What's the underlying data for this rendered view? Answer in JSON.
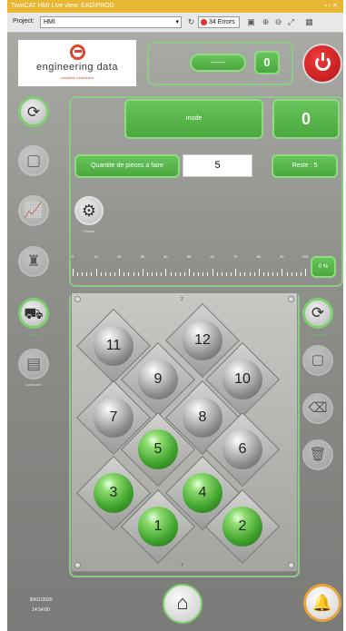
{
  "window": {
    "title": "TwinCAT HMI Live view: EAD\\PROD",
    "controls": "▪ ▫ ✕"
  },
  "toolbar": {
    "project_label": "Project:",
    "project_value": "HMI",
    "errors_label": "34 Errors"
  },
  "logo": {
    "name": "engineering data",
    "tagline": "complete confidence"
  },
  "top_panel": {
    "pill_label": "——",
    "counter_value": "0"
  },
  "main": {
    "mode_label": "mode",
    "counter_value": "0",
    "quantity_label": "Quantite de pieces a faire",
    "quantity_value": "5",
    "remaining_label": "Reste : 5",
    "settings_caption": "Param",
    "progress_label": "0 %",
    "progress_percent": 0,
    "ruler_labels": [
      "0",
      "10",
      "20",
      "30",
      "40",
      "50",
      "60",
      "70",
      "80",
      "90",
      "100"
    ]
  },
  "left_nav": [
    {
      "icon": "overview-icon",
      "caption": "Production",
      "active": true
    },
    {
      "icon": "window-icon",
      "caption": "",
      "active": false
    },
    {
      "icon": "chart-icon",
      "caption": "",
      "active": false
    },
    {
      "icon": "operator-icon",
      "caption": "",
      "active": false
    },
    {
      "icon": "cart-icon",
      "caption": "Produit",
      "active": true
    },
    {
      "icon": "calendar-icon",
      "caption": "Calendrier",
      "active": false
    }
  ],
  "right_nav": [
    {
      "icon": "overview-icon",
      "caption": "Production",
      "active": true
    },
    {
      "icon": "window-icon",
      "caption": "",
      "active": false
    },
    {
      "icon": "erase-icon",
      "caption": "",
      "active": false
    },
    {
      "icon": "trash-icon",
      "caption": "",
      "active": false
    }
  ],
  "tray": {
    "top_number": "2",
    "bottom_number": "7",
    "positions": [
      {
        "label": "11",
        "state": "grey"
      },
      {
        "label": "12",
        "state": "grey"
      },
      {
        "label": "9",
        "state": "grey"
      },
      {
        "label": "10",
        "state": "grey"
      },
      {
        "label": "7",
        "state": "grey"
      },
      {
        "label": "8",
        "state": "grey"
      },
      {
        "label": "5",
        "state": "green"
      },
      {
        "label": "6",
        "state": "grey"
      },
      {
        "label": "3",
        "state": "green"
      },
      {
        "label": "4",
        "state": "green"
      },
      {
        "label": "1",
        "state": "green"
      },
      {
        "label": "2",
        "state": "green"
      }
    ]
  },
  "footer": {
    "date": "30/01/2020",
    "time": "14:54:00"
  },
  "colors": {
    "accent_green": "#5bb74d",
    "power_red": "#d21e1e",
    "title_bar": "#e7b733",
    "alarm_orange": "#e9a13c"
  }
}
